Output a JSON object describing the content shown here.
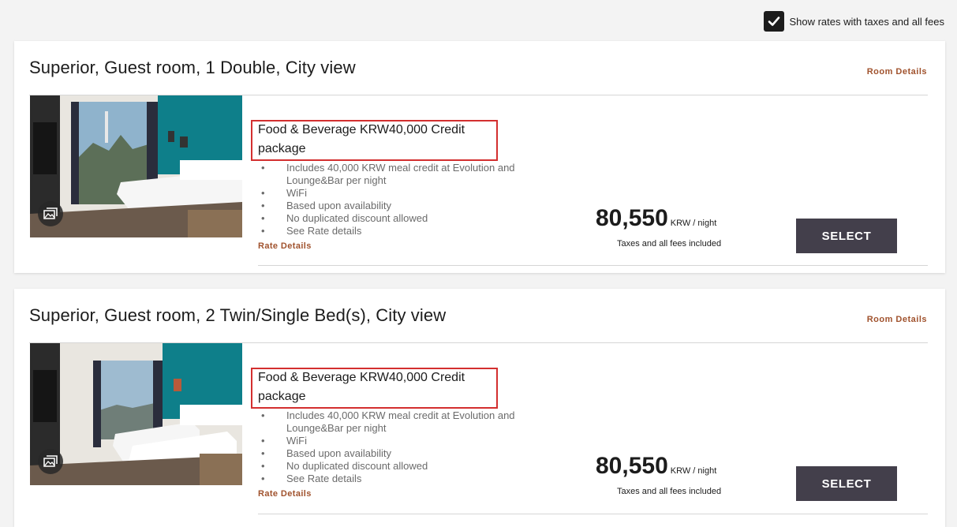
{
  "header": {
    "show_taxes_label": "Show rates with taxes and all fees",
    "show_taxes_checked": true
  },
  "rooms": [
    {
      "title": "Superior, Guest room, 1 Double, City view",
      "room_details_label": "Room Details",
      "photo_icon": "gallery-icon",
      "rate": {
        "name": "Food & Beverage KRW40,000 Credit package",
        "features": [
          "Includes 40,000 KRW meal credit at Evolution and Lounge&Bar per night",
          "WiFi",
          "Based upon availability",
          "No duplicated discount allowed",
          "See Rate details"
        ],
        "rate_details_label": "Rate Details",
        "price": "80,550",
        "price_unit": "KRW / night",
        "price_note": "Taxes and all fees included",
        "select_label": "SELECT"
      }
    },
    {
      "title": "Superior, Guest room, 2 Twin/Single Bed(s), City view",
      "room_details_label": "Room Details",
      "photo_icon": "gallery-icon",
      "rate": {
        "name": "Food & Beverage KRW40,000 Credit package",
        "features": [
          "Includes 40,000 KRW meal credit at Evolution and Lounge&Bar per night",
          "WiFi",
          "Based upon availability",
          "No duplicated discount allowed",
          "See Rate details"
        ],
        "rate_details_label": "Rate Details",
        "price": "80,550",
        "price_unit": "KRW / night",
        "price_note": "Taxes and all fees included",
        "select_label": "SELECT"
      }
    }
  ],
  "colors": {
    "accent_link": "#a0522d",
    "select_button": "#433f4b",
    "highlight": "#d32f2f",
    "room_wall": "#0e7f8a"
  }
}
